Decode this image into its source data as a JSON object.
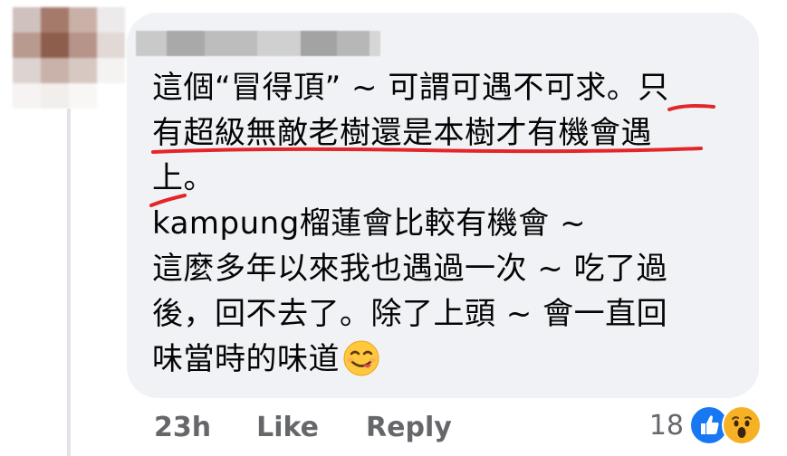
{
  "comment": {
    "lines": [
      "這個“冒得頂” ~ 可謂可遇不可求。只",
      "有超級無敵老樹還是本樹才有機會遇",
      "上。",
      "kampung榴蓮會比較有機會 ~",
      "這麼多年以來我也遇過一次 ~ 吃了過",
      "後，回不去了。除了上頭 ~ 會一直回",
      "味當時的味道"
    ],
    "trailing_emoji": "smiling-face-savoring-food-icon"
  },
  "actions": {
    "time": "23h",
    "like_label": "Like",
    "reply_label": "Reply"
  },
  "reactions": {
    "count": "18",
    "icons": [
      "like-reaction-icon",
      "wow-reaction-icon"
    ]
  },
  "colors": {
    "bubble": "#f0f2f5",
    "text": "#050505",
    "meta": "#65676b",
    "annotation": "#e4262b",
    "like_blue": "#1877f2"
  }
}
